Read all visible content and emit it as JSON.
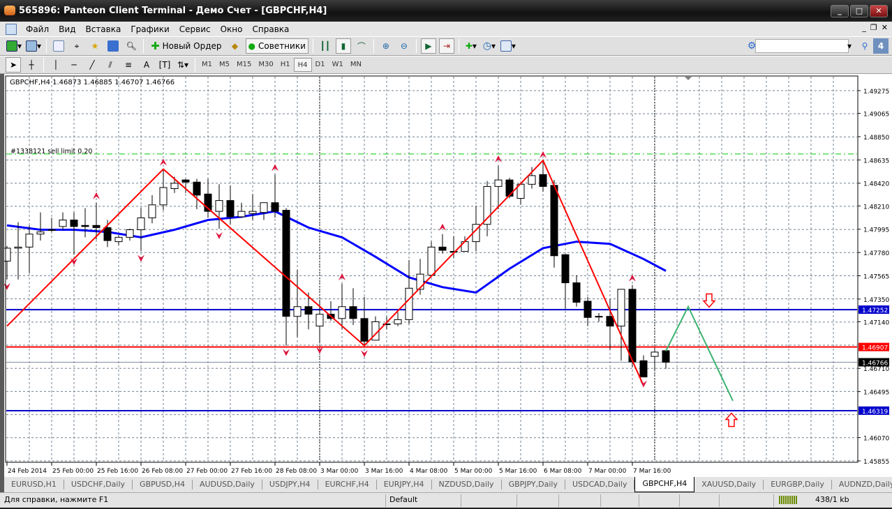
{
  "window": {
    "title": "565896: Panteon Client Terminal - Демо Счет - [GBPCHF,H4]",
    "buttons": [
      "_",
      "□",
      "✕"
    ]
  },
  "menu": {
    "items": [
      "Файл",
      "Вид",
      "Вставка",
      "Графики",
      "Сервис",
      "Окно",
      "Справка"
    ],
    "mdi_buttons": [
      "_",
      "❐",
      "✕"
    ]
  },
  "toolbar": {
    "new_order": "Новый Ордер",
    "experts": "Советники",
    "timeframes": [
      "M1",
      "M5",
      "M15",
      "M30",
      "H1",
      "H4",
      "D1",
      "W1",
      "MN"
    ],
    "active_timeframe": "H4",
    "search_value": "",
    "notification_count": "4"
  },
  "chart": {
    "header": "GBPCHF,H4  1.46873 1.46885 1.46707 1.46766",
    "order_label": "#1338121 sell limit 0.20",
    "colors": {
      "bull": "#ffffff",
      "bear": "#000000",
      "ma": "#0000ff",
      "zigzag": "#ff0000",
      "forecast": "#3cb371",
      "grid": "#708090",
      "sell_limit": "#00cc00",
      "fractal": "#dc143c"
    }
  },
  "chart_data": {
    "type": "candlestick",
    "symbol": "GBPCHF",
    "timeframe": "H4",
    "ylim": [
      1.45855,
      1.49275
    ],
    "y_ticks": [
      "1.49275",
      "1.49065",
      "1.48850",
      "1.48635",
      "1.48420",
      "1.48210",
      "1.47995",
      "1.47780",
      "1.47565",
      "1.47350",
      "1.47140",
      "1.46710",
      "1.46495",
      "1.46070",
      "1.45855"
    ],
    "x_ticks": [
      {
        "i": 0,
        "label": "24 Feb 2014"
      },
      {
        "i": 4,
        "label": "25 Feb 00:00"
      },
      {
        "i": 8,
        "label": "25 Feb 16:00"
      },
      {
        "i": 12,
        "label": "26 Feb 08:00"
      },
      {
        "i": 16,
        "label": "27 Feb 00:00"
      },
      {
        "i": 20,
        "label": "27 Feb 16:00"
      },
      {
        "i": 24,
        "label": "28 Feb 08:00"
      },
      {
        "i": 28,
        "label": "3 Mar 00:00"
      },
      {
        "i": 32,
        "label": "3 Mar 16:00"
      },
      {
        "i": 36,
        "label": "4 Mar 08:00"
      },
      {
        "i": 40,
        "label": "5 Mar 00:00"
      },
      {
        "i": 44,
        "label": "5 Mar 16:00"
      },
      {
        "i": 48,
        "label": "6 Mar 08:00"
      },
      {
        "i": 52,
        "label": "7 Mar 00:00"
      },
      {
        "i": 56,
        "label": "7 Mar 16:00"
      }
    ],
    "ohlc": [
      [
        1.477,
        1.4784,
        1.4753,
        1.4782
      ],
      [
        1.4782,
        1.4806,
        1.4753,
        1.4783
      ],
      [
        1.4783,
        1.4803,
        1.4759,
        1.4795
      ],
      [
        1.4795,
        1.4815,
        1.4789,
        1.4797
      ],
      [
        1.4799,
        1.481,
        1.4797,
        1.4799
      ],
      [
        1.4802,
        1.4815,
        1.4799,
        1.4808
      ],
      [
        1.4808,
        1.4815,
        1.4776,
        1.4802
      ],
      [
        1.4803,
        1.4819,
        1.4792,
        1.4802
      ],
      [
        1.4803,
        1.4824,
        1.479,
        1.4801
      ],
      [
        1.4801,
        1.4808,
        1.4783,
        1.4789
      ],
      [
        1.4788,
        1.4794,
        1.4785,
        1.4792
      ],
      [
        1.4792,
        1.48,
        1.4789,
        1.4799
      ],
      [
        1.4799,
        1.4819,
        1.4779,
        1.481
      ],
      [
        1.481,
        1.4831,
        1.4805,
        1.4822
      ],
      [
        1.4822,
        1.4855,
        1.4817,
        1.4838
      ],
      [
        1.4837,
        1.4848,
        1.4833,
        1.4842
      ],
      [
        1.4845,
        1.4846,
        1.4833,
        1.4843
      ],
      [
        1.4843,
        1.4846,
        1.4818,
        1.4831
      ],
      [
        1.4832,
        1.4846,
        1.481,
        1.4816
      ],
      [
        1.4816,
        1.4841,
        1.48,
        1.4826
      ],
      [
        1.4826,
        1.484,
        1.4804,
        1.4811
      ],
      [
        1.4811,
        1.4824,
        1.481,
        1.4816
      ],
      [
        1.4814,
        1.4832,
        1.4808,
        1.4816
      ],
      [
        1.4815,
        1.4824,
        1.4808,
        1.4824
      ],
      [
        1.4824,
        1.485,
        1.481,
        1.4816
      ],
      [
        1.4817,
        1.4819,
        1.4692,
        1.4719
      ],
      [
        1.4719,
        1.4762,
        1.47,
        1.4728
      ],
      [
        1.4728,
        1.4741,
        1.4707,
        1.4721
      ],
      [
        1.471,
        1.4733,
        1.4694,
        1.4721
      ],
      [
        1.4721,
        1.4733,
        1.4715,
        1.4717
      ],
      [
        1.4717,
        1.4749,
        1.4707,
        1.4728
      ],
      [
        1.4728,
        1.4745,
        1.4711,
        1.4717
      ],
      [
        1.4717,
        1.4737,
        1.4691,
        1.4696
      ],
      [
        1.4697,
        1.4719,
        1.4697,
        1.4714
      ],
      [
        1.4712,
        1.4719,
        1.4707,
        1.4712
      ],
      [
        1.4712,
        1.4723,
        1.471,
        1.4716
      ],
      [
        1.4716,
        1.4771,
        1.4712,
        1.4745
      ],
      [
        1.4744,
        1.4772,
        1.4739,
        1.4758
      ],
      [
        1.4757,
        1.4788,
        1.4757,
        1.4783
      ],
      [
        1.4783,
        1.4795,
        1.4777,
        1.478
      ],
      [
        1.4779,
        1.4793,
        1.4773,
        1.4779
      ],
      [
        1.4779,
        1.4793,
        1.4779,
        1.4788
      ],
      [
        1.4788,
        1.4821,
        1.4779,
        1.4804
      ],
      [
        1.4804,
        1.4844,
        1.4793,
        1.4839
      ],
      [
        1.4839,
        1.4858,
        1.4818,
        1.4845
      ],
      [
        1.4845,
        1.4847,
        1.4828,
        1.483
      ],
      [
        1.4828,
        1.4841,
        1.4822,
        1.4841
      ],
      [
        1.4841,
        1.4857,
        1.4837,
        1.4849
      ],
      [
        1.485,
        1.4862,
        1.4834,
        1.4839
      ],
      [
        1.484,
        1.4845,
        1.4764,
        1.4775
      ],
      [
        1.4776,
        1.4776,
        1.4726,
        1.475
      ],
      [
        1.475,
        1.4757,
        1.4728,
        1.4732
      ],
      [
        1.4733,
        1.4737,
        1.471,
        1.4718
      ],
      [
        1.4719,
        1.4722,
        1.4714,
        1.4719
      ],
      [
        1.4719,
        1.4735,
        1.4688,
        1.471
      ],
      [
        1.471,
        1.4744,
        1.4678,
        1.4744
      ],
      [
        1.4744,
        1.4748,
        1.4672,
        1.4677
      ],
      [
        1.4678,
        1.4683,
        1.4663,
        1.4663
      ],
      [
        1.4682,
        1.4689,
        1.4669,
        1.4686
      ],
      [
        1.46873,
        1.46885,
        1.46707,
        1.46766
      ]
    ],
    "moving_average": [
      [
        0,
        1.4803
      ],
      [
        3,
        1.4799
      ],
      [
        6,
        1.4799
      ],
      [
        9,
        1.4797
      ],
      [
        12,
        1.4792
      ],
      [
        15,
        1.4799
      ],
      [
        18,
        1.4808
      ],
      [
        21,
        1.4811
      ],
      [
        24,
        1.4816
      ],
      [
        27,
        1.4801
      ],
      [
        30,
        1.4792
      ],
      [
        33,
        1.4774
      ],
      [
        36,
        1.4755
      ],
      [
        39,
        1.4746
      ],
      [
        42,
        1.4741
      ],
      [
        45,
        1.4763
      ],
      [
        48,
        1.4782
      ],
      [
        51,
        1.4788
      ],
      [
        54,
        1.4786
      ],
      [
        57,
        1.4772
      ],
      [
        59,
        1.4761
      ]
    ],
    "zigzag": [
      [
        0,
        1.471
      ],
      [
        14,
        1.4855
      ],
      [
        32,
        1.4692
      ],
      [
        48,
        1.4863
      ],
      [
        57,
        1.4655
      ]
    ],
    "fractals_up": [
      8,
      14,
      24,
      30,
      39,
      44,
      48,
      56
    ],
    "fractals_down": [
      0,
      6,
      12,
      19,
      25,
      28,
      32,
      57
    ],
    "forecast": [
      [
        59,
        1.4687
      ],
      [
        61,
        1.4728
      ],
      [
        65,
        1.4641
      ]
    ],
    "forecast_arrows": [
      {
        "dir": "down",
        "i": 63,
        "price": 1.4732
      },
      {
        "dir": "up",
        "i": 65,
        "price": 1.4625
      }
    ],
    "hlines": [
      {
        "price": 1.4869,
        "label": "",
        "kind": "sell_limit"
      },
      {
        "price": 1.47252,
        "label": "1.47252",
        "kind": "blue"
      },
      {
        "price": 1.46907,
        "label": "1.46907",
        "kind": "red"
      },
      {
        "price": 1.46766,
        "label": "1.46766",
        "kind": "bid"
      },
      {
        "price": 1.46319,
        "label": "1.46319",
        "kind": "blue"
      }
    ],
    "period_separators": [
      28,
      58
    ]
  },
  "tabs": [
    "EURUSD,H1",
    "USDCHF,Daily",
    "GBPUSD,H4",
    "AUDUSD,Daily",
    "USDJPY,H4",
    "EURCHF,H4",
    "EURJPY,H4",
    "NZDUSD,Daily",
    "GBPJPY,Daily",
    "USDCAD,Daily",
    "GBPCHF,H4",
    "XAUUSD,Daily",
    "EURGBP,Daily",
    "AUDNZD,Daily"
  ],
  "active_tab": "GBPCHF,H4",
  "status": {
    "help": "Для справки, нажмите F1",
    "profile": "Default",
    "traffic": "438/1 kb"
  }
}
